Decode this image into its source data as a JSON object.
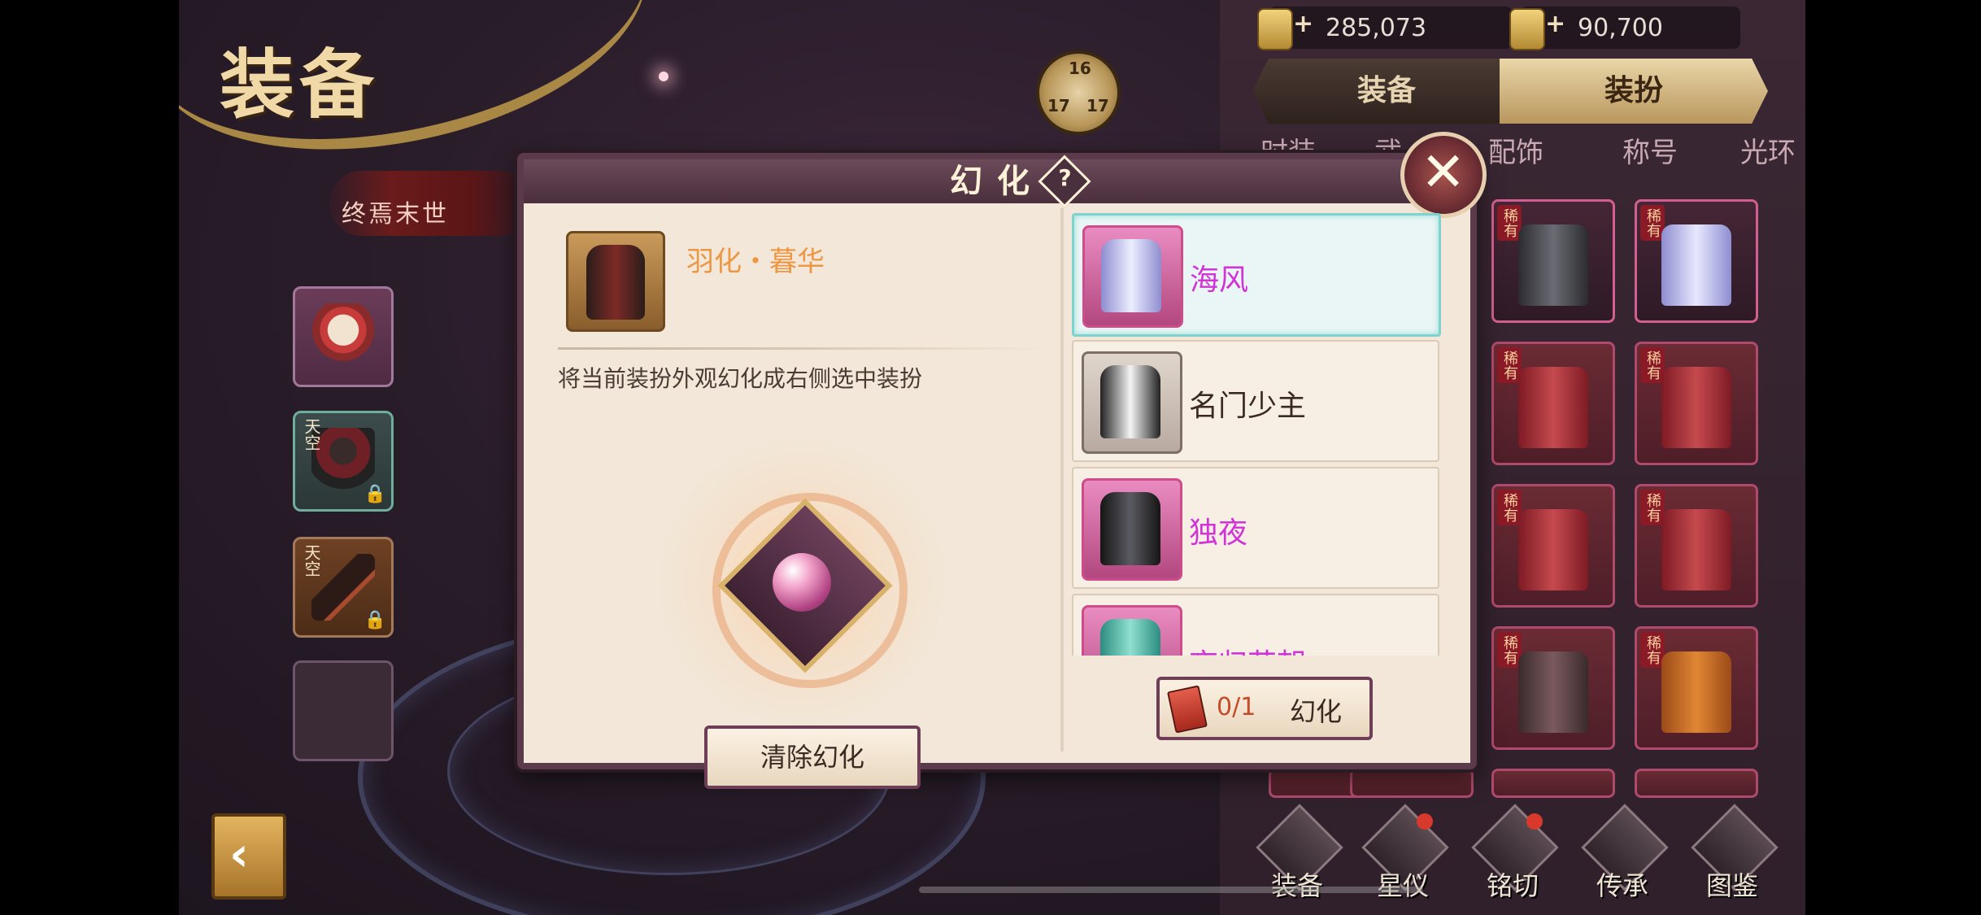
{
  "screen_title": "装备",
  "emblem_text": "终焉末世",
  "clock": {
    "n1": "16",
    "n2": "17",
    "n3": "17"
  },
  "currency": [
    {
      "icon": "gold-coupon-icon",
      "amount": "285,073"
    },
    {
      "icon": "silver-coupon-icon",
      "amount": "90,700"
    }
  ],
  "top_tabs": [
    {
      "label": "装备",
      "active": false
    },
    {
      "label": "装扮",
      "active": true
    }
  ],
  "sub_tabs": [
    "时装",
    "武",
    "配饰",
    "称号",
    "光环"
  ],
  "left_slots": [
    {
      "tag": ""
    },
    {
      "tag": "天空"
    },
    {
      "tag": "天空"
    },
    {
      "tag": ""
    }
  ],
  "grid_tag": "稀有",
  "modal": {
    "title": "幻化",
    "help": "?",
    "close": "✕",
    "current_item_name": "羽化・暮华",
    "description": "将当前装扮外观幻化成右侧选中装扮",
    "clear_button": "清除幻化",
    "list": [
      {
        "name": "海风",
        "selected": true
      },
      {
        "name": "名门少主",
        "selected": false
      },
      {
        "name": "独夜",
        "selected": false
      },
      {
        "name": "夜归花朝",
        "selected": false
      }
    ],
    "convert_count": "0/1",
    "convert_button": "幻化"
  },
  "bottom_nav": [
    {
      "label": "装备",
      "badge": false
    },
    {
      "label": "星仪",
      "badge": true
    },
    {
      "label": "铭切",
      "badge": true
    },
    {
      "label": "传承",
      "badge": false
    },
    {
      "label": "图鉴",
      "badge": false
    }
  ],
  "colors": {
    "accent_orange": "#ec9744",
    "item_magenta": "#d233d7",
    "modal_border": "#5b3b4b",
    "selected_highlight": "#7fd3cf"
  }
}
